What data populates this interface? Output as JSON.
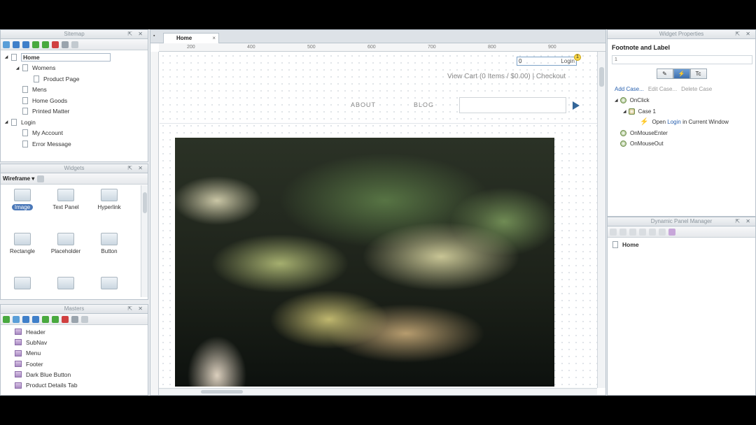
{
  "sitemap": {
    "title": "Sitemap",
    "items": [
      {
        "label": "Home",
        "level": 0,
        "expanded": true,
        "selected": true
      },
      {
        "label": "Womens",
        "level": 1,
        "expanded": true
      },
      {
        "label": "Product Page",
        "level": 2
      },
      {
        "label": "Mens",
        "level": 1
      },
      {
        "label": "Home Goods",
        "level": 1
      },
      {
        "label": "Printed Matter",
        "level": 1
      },
      {
        "label": "Login",
        "level": 0,
        "expanded": true
      },
      {
        "label": "My Account",
        "level": 1
      },
      {
        "label": "Error Message",
        "level": 1
      }
    ]
  },
  "widgets": {
    "title": "Widgets",
    "library": "Wireframe",
    "items": [
      {
        "label": "Image",
        "selected": true
      },
      {
        "label": "Text Panel"
      },
      {
        "label": "Hyperlink"
      },
      {
        "label": "Rectangle"
      },
      {
        "label": "Placeholder"
      },
      {
        "label": "Button"
      },
      {
        "label": ""
      },
      {
        "label": ""
      },
      {
        "label": ""
      }
    ]
  },
  "masters": {
    "title": "Masters",
    "items": [
      "Header",
      "SubNav",
      "Menu",
      "Footer",
      "Dark Blue Button",
      "Product Details Tab"
    ]
  },
  "canvas": {
    "tab_label": "Home",
    "tab_close": "×",
    "ruler_ticks": [
      "200",
      "400",
      "500",
      "600",
      "700",
      "800",
      "900"
    ],
    "login_box_value": "0",
    "login_link": "Login",
    "footnote_badge": "1",
    "cart_text": "View Cart (0 Items / $0.00) | Checkout",
    "nav": {
      "about": "ABOUT",
      "blog": "BLOG"
    }
  },
  "widget_properties": {
    "title": "Widget Properties",
    "heading": "Footnote and Label",
    "footnote_value": "1",
    "tabs": [
      "",
      "",
      "Tc"
    ],
    "case_links": {
      "add": "Add Case...",
      "edit": "Edit Case...",
      "delete": "Delete Case"
    },
    "events": {
      "onclick": "OnClick",
      "case": "Case 1",
      "action_prefix": "Open",
      "action_link": "Login",
      "action_suffix": "in Current Window",
      "mouse_enter": "OnMouseEnter",
      "mouse_out": "OnMouseOut"
    }
  },
  "dynamic_panel_manager": {
    "title": "Dynamic Panel Manager",
    "items": [
      "Home"
    ]
  },
  "colors": {
    "accent": "#336699",
    "selection": "#4b78b8",
    "link": "#2a62b0"
  }
}
